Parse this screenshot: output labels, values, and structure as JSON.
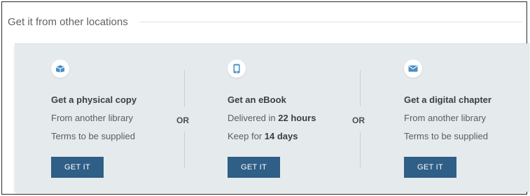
{
  "section": {
    "title": "Get it from other locations"
  },
  "options": [
    {
      "icon": "package-icon",
      "title": "Get a physical copy",
      "line1": "From another library",
      "line2": "Terms to be supplied",
      "button": "GET IT"
    },
    {
      "icon": "tablet-icon",
      "title": "Get an eBook",
      "line1_prefix": "Delivered in ",
      "line1_bold": "22 hours",
      "line2_prefix": "Keep for ",
      "line2_bold": "14 days",
      "button": "GET IT"
    },
    {
      "icon": "envelope-icon",
      "title": "Get a digital chapter",
      "line1": "From another library",
      "line2": "Terms to be supplied",
      "button": "GET IT"
    }
  ],
  "separators": [
    "OR",
    "OR"
  ],
  "colors": {
    "button": "#2f5e87",
    "panel": "#e5eaed",
    "icon": "#4a8fc4"
  }
}
